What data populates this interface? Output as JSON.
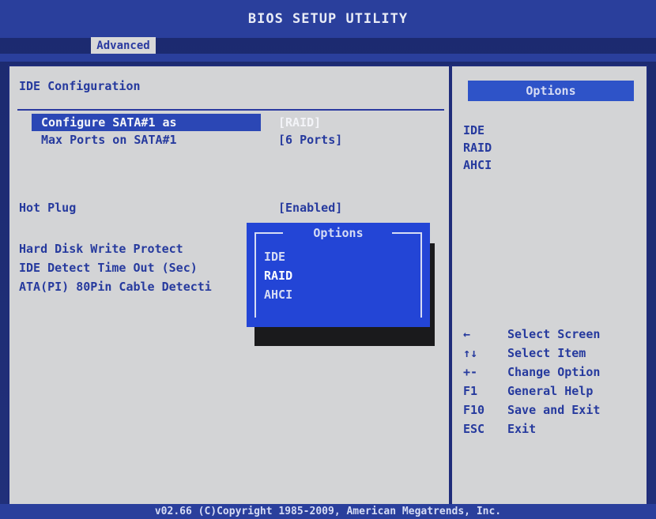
{
  "header": {
    "title": "BIOS SETUP UTILITY",
    "active_tab": "Advanced"
  },
  "main": {
    "section_title": "IDE Configuration",
    "rows": [
      {
        "label": "Configure SATA#1 as",
        "value": "[RAID]"
      },
      {
        "label": "Max Ports on SATA#1",
        "value": "[6 Ports]"
      },
      {
        "label": "Hot Plug",
        "value": "[Enabled]"
      },
      {
        "label": "Hard Disk Write Protect",
        "value": ""
      },
      {
        "label": "IDE Detect Time Out (Sec)",
        "value": ""
      },
      {
        "label": "ATA(PI) 80Pin Cable Detecti",
        "value": ""
      }
    ]
  },
  "popup": {
    "title": "Options",
    "items": [
      "IDE",
      "RAID",
      "AHCI"
    ],
    "selected": "RAID"
  },
  "help": {
    "header": "Options",
    "options": [
      "IDE",
      "RAID",
      "AHCI"
    ],
    "keys": [
      {
        "key": "←",
        "desc": "Select Screen"
      },
      {
        "key": "↑↓",
        "desc": "Select Item"
      },
      {
        "key": "+-",
        "desc": "Change Option"
      },
      {
        "key": "F1",
        "desc": "General Help"
      },
      {
        "key": "F10",
        "desc": "Save and Exit"
      },
      {
        "key": "ESC",
        "desc": "Exit"
      }
    ]
  },
  "footer": {
    "text": "v02.66 (C)Copyright 1985-2009, American Megatrends, Inc."
  }
}
